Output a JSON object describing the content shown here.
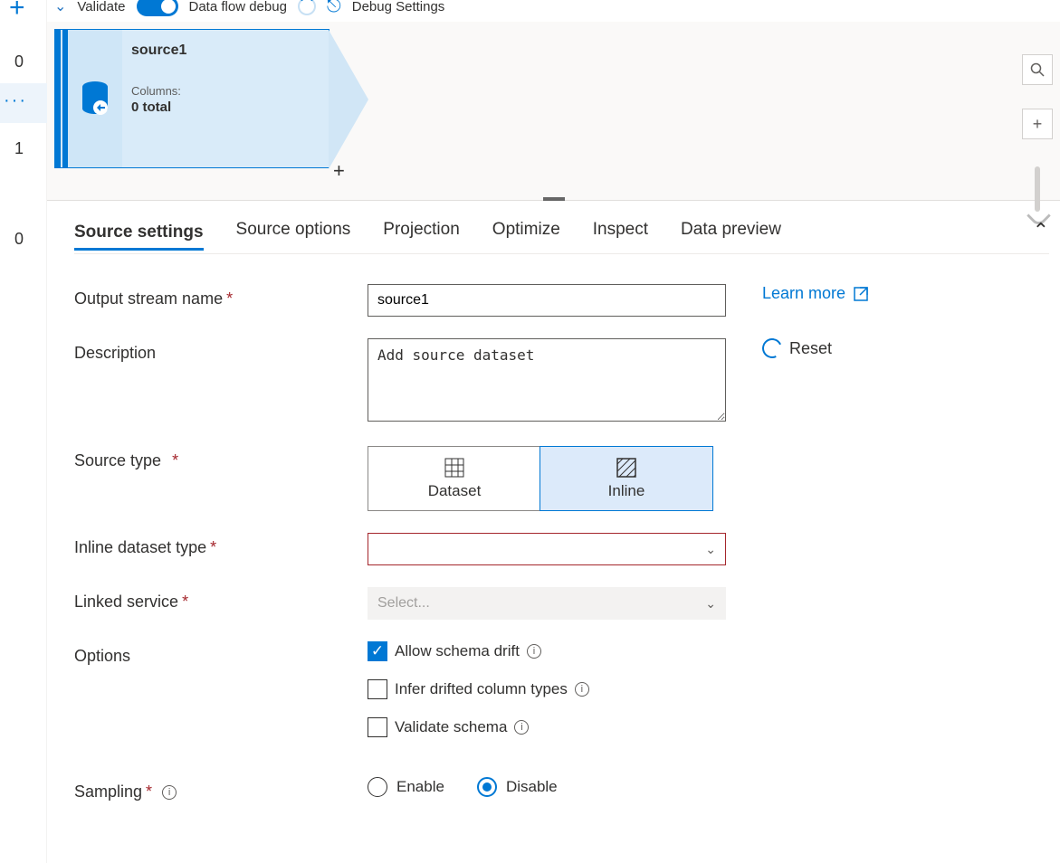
{
  "topbar": {
    "validate": "Validate",
    "debug_toggle_label": "Data flow debug",
    "debug_settings": "Debug Settings"
  },
  "rail": {
    "num_top": "0",
    "num_mid": "1",
    "num_bot": "0"
  },
  "source_node": {
    "title": "source1",
    "columns_label": "Columns:",
    "columns_value": "0 total"
  },
  "tabs": [
    "Source settings",
    "Source options",
    "Projection",
    "Optimize",
    "Inspect",
    "Data preview"
  ],
  "active_tab_index": 0,
  "form": {
    "output_stream_name": {
      "label": "Output stream name",
      "value": "source1"
    },
    "learn_more": "Learn more",
    "description": {
      "label": "Description",
      "value": "Add source dataset"
    },
    "reset": "Reset",
    "source_type": {
      "label": "Source type",
      "opt_dataset": "Dataset",
      "opt_inline": "Inline"
    },
    "inline_dataset_type": {
      "label": "Inline dataset type",
      "value": ""
    },
    "linked_service": {
      "label": "Linked service",
      "placeholder": "Select..."
    },
    "options": {
      "label": "Options",
      "allow_schema_drift": "Allow schema drift",
      "infer_types": "Infer drifted column types",
      "validate_schema": "Validate schema"
    },
    "sampling": {
      "label": "Sampling",
      "enable": "Enable",
      "disable": "Disable"
    }
  }
}
